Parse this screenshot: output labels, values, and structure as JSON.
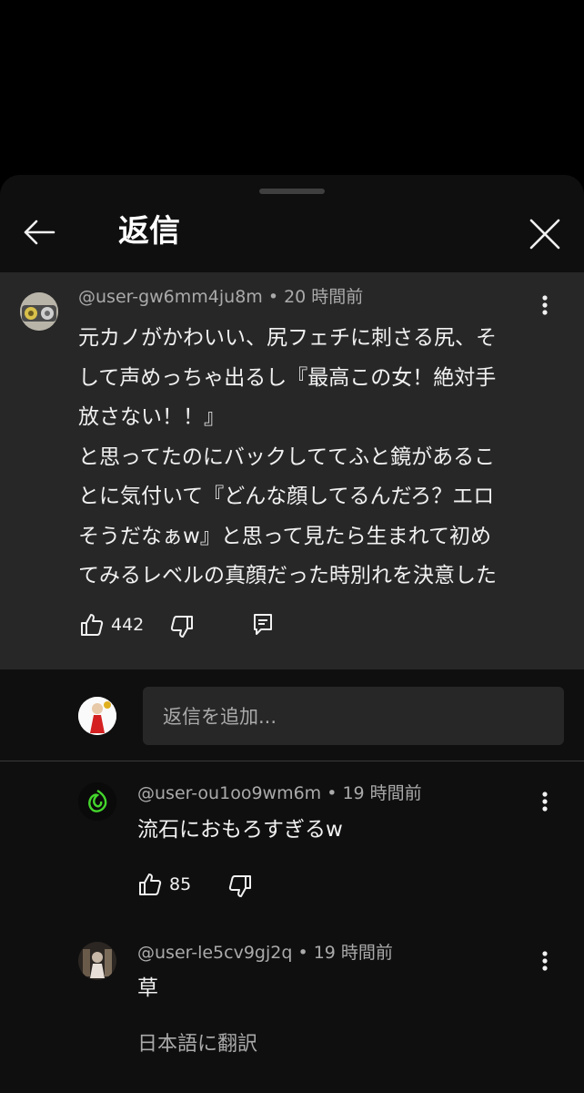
{
  "header": {
    "title": "返信"
  },
  "parent_comment": {
    "author": "@user-gw6mm4ju8m",
    "time": " • 20 時間前",
    "text": "元カノがかわいい、尻フェチに刺さる尻、そ\nして声めっちゃ出るし『最高この女！絶対手\n放さない！！』\nと思ってたのにバックしててふと鏡があるこ\nとに気付いて『どんな顔してるんだろ？エロ\nそうだなぁw』と思って見たら生まれて初め\nてみるレベルの真顔だった時別れを決意した",
    "likes": "442"
  },
  "reply_box": {
    "placeholder": "返信を追加..."
  },
  "replies": [
    {
      "author": "@user-ou1oo9wm6m",
      "time": " • 19 時間前",
      "text": "流石におもろすぎるw",
      "likes": "85"
    },
    {
      "author": "@user-le5cv9gj2q",
      "time": " • 19 時間前",
      "text": "草",
      "translate": "日本語に翻訳"
    }
  ],
  "colors": {
    "sheet_bg": "#0f0f0f",
    "highlight_bg": "#272727",
    "secondary_text": "#aaaaaa",
    "primary_text": "#f1f1f1"
  }
}
